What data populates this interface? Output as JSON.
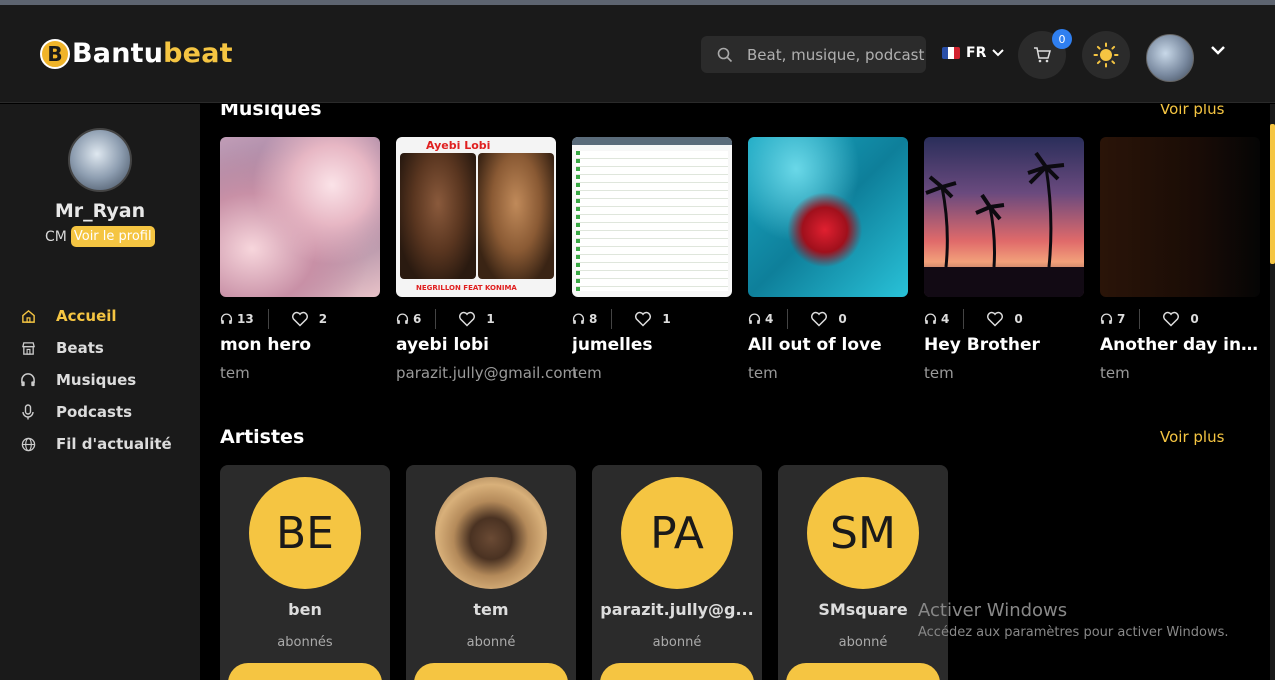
{
  "app": {
    "name_part1": "Bantu",
    "name_part2": "beat",
    "logo_letter": "B"
  },
  "colors": {
    "accent": "#f5c542",
    "background": "#000000",
    "panel": "#1a1a1a",
    "card": "#2b2b2b",
    "badge": "#2f7ff0"
  },
  "header": {
    "search_placeholder": "Beat, musique, podcast",
    "language": "FR",
    "cart_count": "0",
    "icons": [
      "search-icon",
      "fr-flag-icon",
      "chevron-down-icon",
      "cart-icon",
      "sun-icon",
      "avatar",
      "chevron-down-icon"
    ]
  },
  "sidebar": {
    "profile": {
      "name": "Mr_Ryan",
      "role": "CM",
      "link": "Voir le profil"
    },
    "items": [
      {
        "label": "Accueil",
        "icon": "home-icon",
        "active": true
      },
      {
        "label": "Beats",
        "icon": "store-icon",
        "active": false
      },
      {
        "label": "Musiques",
        "icon": "headphones-icon",
        "active": false
      },
      {
        "label": "Podcasts",
        "icon": "mic-icon",
        "active": false
      },
      {
        "label": "Fil d'actualité",
        "icon": "globe-icon",
        "active": false
      }
    ]
  },
  "musics": {
    "title": "Musiques",
    "see_more": "Voir plus",
    "items": [
      {
        "listens": "13",
        "likes": "2",
        "title": "mon hero",
        "artist": "tem"
      },
      {
        "listens": "6",
        "likes": "1",
        "title": "ayebi lobi",
        "artist": "parazit.jully@gmail.com",
        "cover_title": "Ayebi Lobi",
        "cover_caption": "NEGRILLON FEAT KONIMA"
      },
      {
        "listens": "8",
        "likes": "1",
        "title": "jumelles",
        "artist": "tem"
      },
      {
        "listens": "4",
        "likes": "0",
        "title": "All out of love",
        "artist": "tem"
      },
      {
        "listens": "4",
        "likes": "0",
        "title": "Hey Brother",
        "artist": "tem"
      },
      {
        "listens": "7",
        "likes": "0",
        "title": "Another day in ...",
        "artist": "tem"
      }
    ]
  },
  "artists": {
    "title": "Artistes",
    "see_more": "Voir plus",
    "items": [
      {
        "initials": "BE",
        "name": "ben",
        "subscribers": "abonnés"
      },
      {
        "initials": "",
        "name": "tem",
        "subscribers": "abonné"
      },
      {
        "initials": "PA",
        "name": "parazit.jully@g...",
        "subscribers": "abonné"
      },
      {
        "initials": "SM",
        "name": "SMsquare",
        "subscribers": "abonné"
      }
    ]
  },
  "watermark": {
    "line1": "Activer Windows",
    "line2": "Accédez aux paramètres pour activer Windows."
  }
}
